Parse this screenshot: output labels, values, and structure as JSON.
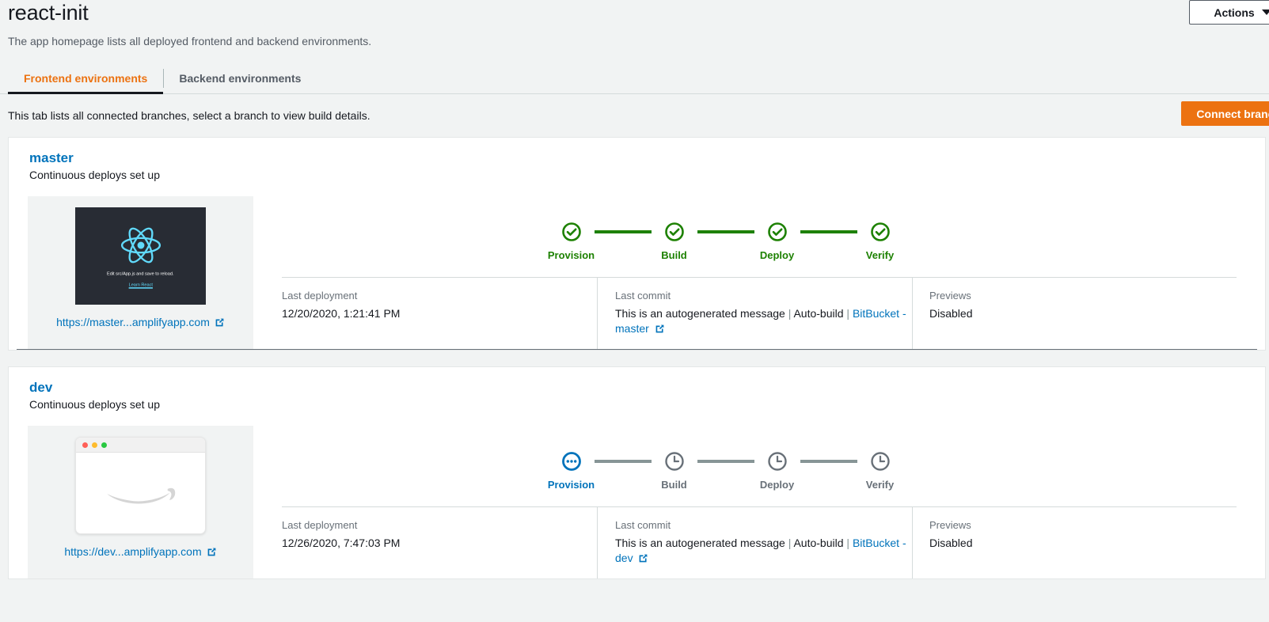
{
  "header": {
    "title": "react-init",
    "description": "The app homepage lists all deployed frontend and backend environments.",
    "actions_label": "Actions"
  },
  "tabs": [
    {
      "label": "Frontend environments",
      "active": true
    },
    {
      "label": "Backend environments",
      "active": false
    }
  ],
  "subbar": {
    "text": "This tab lists all connected branches, select a branch to view build details.",
    "connect_label": "Connect branch"
  },
  "colors": {
    "accent_orange": "#ec7211",
    "link_blue": "#0073bb",
    "success_green": "#1d8102",
    "pending_gray": "#687078",
    "page_bg": "#f1f3f3"
  },
  "detail_labels": {
    "last_deployment": "Last deployment",
    "last_commit": "Last commit",
    "previews": "Previews"
  },
  "thumbnail_react": {
    "caption": "Edit src/App.js and save to reload.",
    "link": "Learn React"
  },
  "branches": [
    {
      "name": "master",
      "status": "Continuous deploys set up",
      "url_label": "https://master...amplifyapp.com",
      "thumbnail": "react-app-screenshot",
      "steps": [
        {
          "label": "Provision",
          "state": "done"
        },
        {
          "label": "Build",
          "state": "done"
        },
        {
          "label": "Deploy",
          "state": "done"
        },
        {
          "label": "Verify",
          "state": "done"
        }
      ],
      "last_deployment": "12/20/2020, 1:21:41 PM",
      "commit_message": "This is an autogenerated message",
      "commit_author": "Auto-build",
      "commit_source": "BitBucket - master",
      "previews": "Disabled"
    },
    {
      "name": "dev",
      "status": "Continuous deploys set up",
      "url_label": "https://dev...amplifyapp.com",
      "thumbnail": "browser-window-amazon-smile",
      "steps": [
        {
          "label": "Provision",
          "state": "running"
        },
        {
          "label": "Build",
          "state": "pending"
        },
        {
          "label": "Deploy",
          "state": "pending"
        },
        {
          "label": "Verify",
          "state": "pending"
        }
      ],
      "last_deployment": "12/26/2020, 7:47:03 PM",
      "commit_message": "This is an autogenerated message",
      "commit_author": "Auto-build",
      "commit_source": "BitBucket - dev",
      "previews": "Disabled"
    }
  ]
}
